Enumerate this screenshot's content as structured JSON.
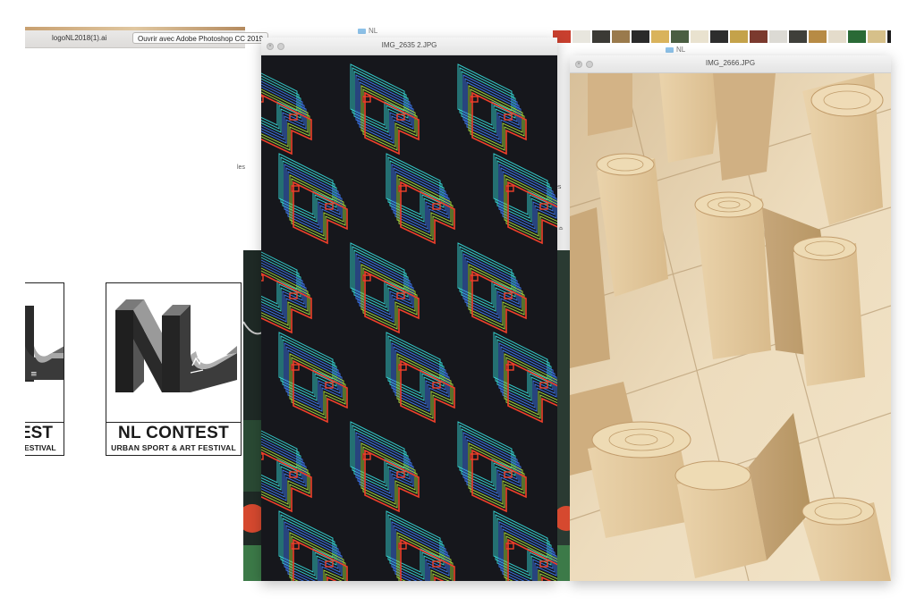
{
  "finder": {
    "file_name": "logoNL2018(1).ai",
    "open_button": "Ouvrir avec Adobe Photoshop CC 2019"
  },
  "logo": {
    "title": "NL CONTEST",
    "subtitle": "URBAN SPORT & ART FESTIVAL",
    "partial_title": "EST",
    "partial_subtitle": "ESTIVAL"
  },
  "folder_labels": {
    "mid": "NL",
    "right": "NL"
  },
  "windows": {
    "mid": {
      "title": "IMG_2635 2.JPG"
    },
    "right": {
      "title": "IMG_2666.JPG"
    }
  },
  "peek_text": {
    "left": "les",
    "mid": "es"
  },
  "icons": {
    "traffic_lights": "window-controls",
    "folder": "folder-icon"
  },
  "colors": {
    "slice_red": "#f0402a",
    "slice_blue": "#3a72e0",
    "slice_cyan": "#33c8c8",
    "slice_green": "#9ccc3a",
    "slice_bg": "#16171c",
    "wood": "#e6cfaa",
    "logo_dark": "#262626"
  }
}
